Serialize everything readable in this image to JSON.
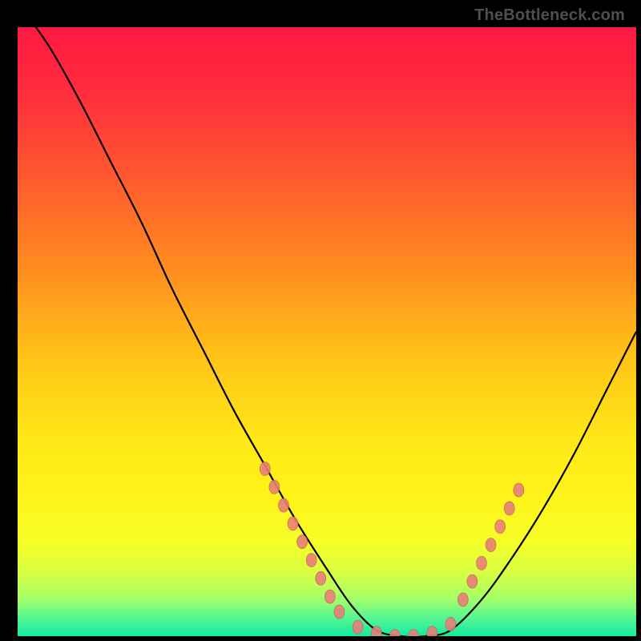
{
  "watermark": {
    "text": "TheBottleneck.com",
    "color": "#4f4f4f"
  },
  "colors": {
    "gradient_stops": [
      {
        "offset": 0.0,
        "color": "#ff1942"
      },
      {
        "offset": 0.1,
        "color": "#ff2b3d"
      },
      {
        "offset": 0.25,
        "color": "#ff5a2e"
      },
      {
        "offset": 0.4,
        "color": "#ff8e1f"
      },
      {
        "offset": 0.55,
        "color": "#ffc617"
      },
      {
        "offset": 0.68,
        "color": "#ffe817"
      },
      {
        "offset": 0.78,
        "color": "#fff51a"
      },
      {
        "offset": 0.85,
        "color": "#f4ff2a"
      },
      {
        "offset": 0.9,
        "color": "#d4ff45"
      },
      {
        "offset": 0.94,
        "color": "#a0ff6a"
      },
      {
        "offset": 0.97,
        "color": "#55f792"
      },
      {
        "offset": 1.0,
        "color": "#13eaa0"
      }
    ],
    "curve": "#000000",
    "marker_fill": "#e78078",
    "marker_stroke": "#c95a52"
  },
  "chart_data": {
    "type": "line",
    "title": "",
    "xlabel": "",
    "ylabel": "",
    "xlim": [
      0,
      100
    ],
    "ylim": [
      0,
      100
    ],
    "grid": false,
    "series": [
      {
        "name": "bottleneck-curve",
        "x": [
          0,
          5,
          10,
          15,
          20,
          25,
          30,
          35,
          40,
          45,
          50,
          54,
          58,
          62,
          66,
          70,
          75,
          80,
          85,
          90,
          95,
          100
        ],
        "y": [
          104,
          97,
          88,
          78,
          68,
          57,
          47,
          37,
          28,
          19,
          11,
          5,
          1,
          0,
          0,
          1,
          6,
          13,
          21,
          30,
          40,
          50
        ]
      }
    ],
    "markers": [
      {
        "x": 40.0,
        "y": 27.5
      },
      {
        "x": 41.5,
        "y": 24.5
      },
      {
        "x": 43.0,
        "y": 21.5
      },
      {
        "x": 44.5,
        "y": 18.5
      },
      {
        "x": 46.0,
        "y": 15.5
      },
      {
        "x": 47.5,
        "y": 12.5
      },
      {
        "x": 49.0,
        "y": 9.5
      },
      {
        "x": 50.5,
        "y": 6.5
      },
      {
        "x": 52.0,
        "y": 4.0
      },
      {
        "x": 55.0,
        "y": 1.5
      },
      {
        "x": 58.0,
        "y": 0.5
      },
      {
        "x": 61.0,
        "y": 0.0
      },
      {
        "x": 64.0,
        "y": 0.0
      },
      {
        "x": 67.0,
        "y": 0.5
      },
      {
        "x": 70.0,
        "y": 2.0
      },
      {
        "x": 72.0,
        "y": 6.0
      },
      {
        "x": 73.5,
        "y": 9.0
      },
      {
        "x": 75.0,
        "y": 12.0
      },
      {
        "x": 76.5,
        "y": 15.0
      },
      {
        "x": 78.0,
        "y": 18.0
      },
      {
        "x": 79.5,
        "y": 21.0
      },
      {
        "x": 81.0,
        "y": 24.0
      }
    ]
  }
}
